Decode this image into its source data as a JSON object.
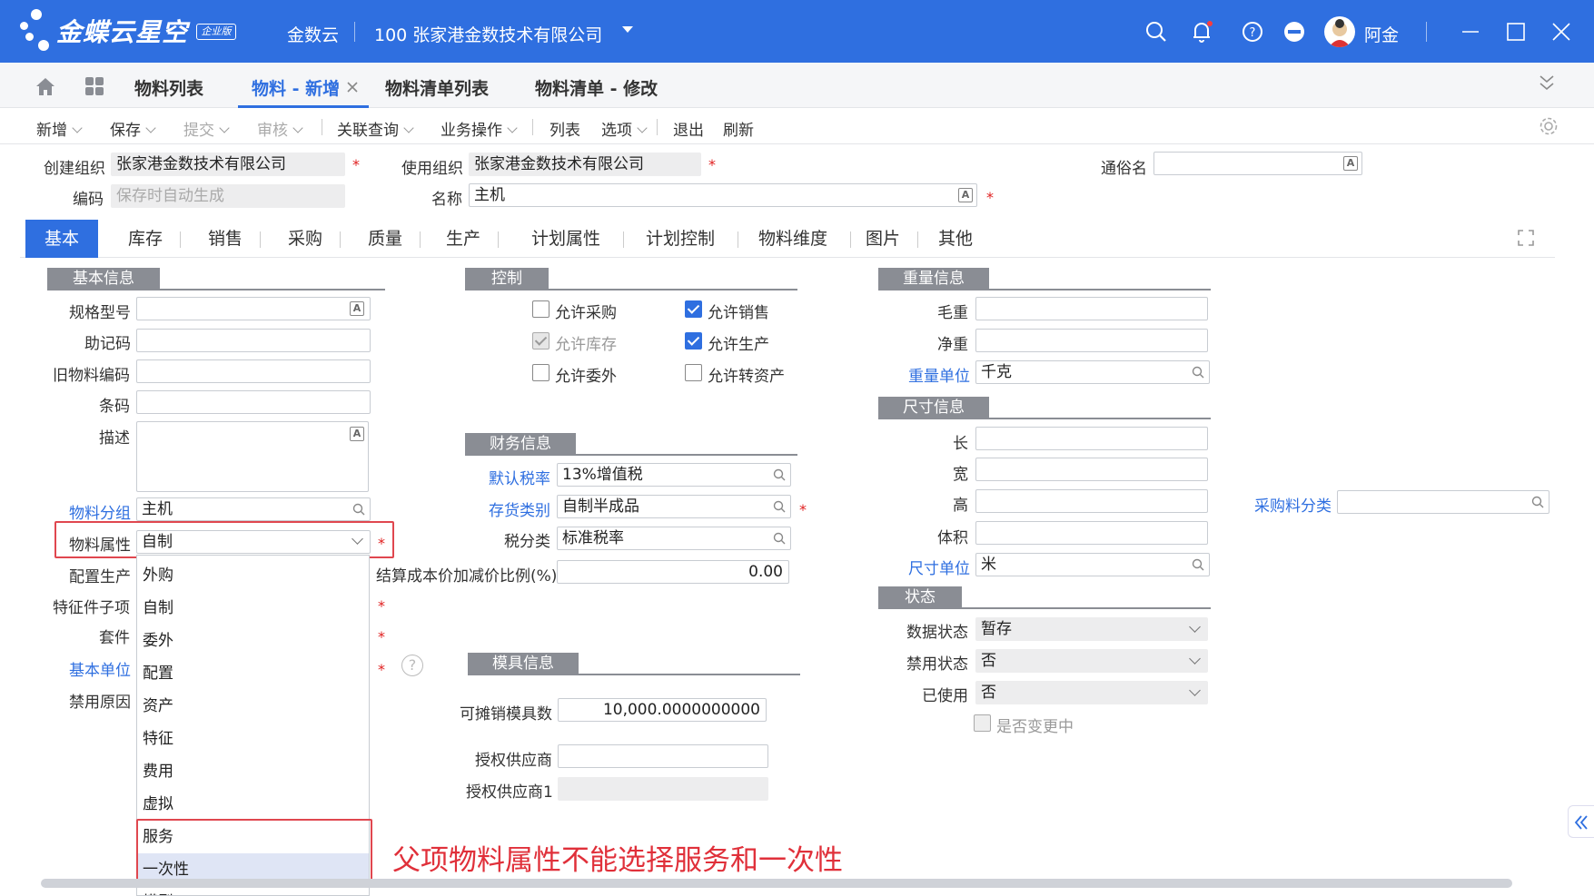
{
  "header": {
    "logo_text": "金蝶云星空",
    "logo_badge": "企业版",
    "product": "金数云",
    "org": "100 张家港金数技术有限公司",
    "username": "阿金",
    "brand_color": "#2f6fe0"
  },
  "tabs": [
    "物料列表",
    "物料 - 新增",
    "物料清单列表",
    "物料清单 - 修改"
  ],
  "toolbar": {
    "new": "新增",
    "save": "保存",
    "submit": "提交",
    "audit": "审核",
    "related": "关联查询",
    "business": "业务操作",
    "list": "列表",
    "options": "选项",
    "exit": "退出",
    "refresh": "刷新"
  },
  "top_form": {
    "create_org_label": "创建组织",
    "create_org_value": "张家港金数技术有限公司",
    "use_org_label": "使用组织",
    "use_org_value": "张家港金数技术有限公司",
    "alias_label": "通俗名",
    "code_label": "编码",
    "code_placeholder": "保存时自动生成",
    "name_label": "名称",
    "name_value": "主机"
  },
  "subtabs": [
    "基本",
    "库存",
    "销售",
    "采购",
    "质量",
    "生产",
    "计划属性",
    "计划控制",
    "物料维度",
    "图片",
    "其他"
  ],
  "basic": {
    "section": "基本信息",
    "spec": "规格型号",
    "mnemonic": "助记码",
    "old_code": "旧物料编码",
    "barcode": "条码",
    "desc": "描述",
    "group_label": "物料分组",
    "group_value": "主机",
    "attr_label": "物料属性",
    "attr_value": "自制",
    "config_prod": "配置生产",
    "feature_sub": "特征件子项",
    "kit": "套件",
    "base_unit": "基本单位",
    "disable_reason": "禁用原因"
  },
  "dropdown": {
    "options": [
      "外购",
      "自制",
      "委外",
      "配置",
      "资产",
      "特征",
      "费用",
      "虚拟",
      "服务",
      "一次性",
      "模型"
    ]
  },
  "annotation": "父项物料属性不能选择服务和一次性",
  "control": {
    "section": "控制",
    "allow_purchase": "允许采购",
    "allow_sales": "允许销售",
    "allow_stock": "允许库存",
    "allow_produce": "允许生产",
    "allow_outsource": "允许委外",
    "allow_asset": "允许转资产"
  },
  "finance": {
    "section": "财务信息",
    "tax_label": "默认税率",
    "tax_value": "13%增值税",
    "stock_cat_label": "存货类别",
    "stock_cat_value": "自制半成品",
    "tax_cat_label": "税分类",
    "tax_cat_value": "标准税率",
    "ratio_label": "结算成本价加减价比例(%)",
    "ratio_value": "0.00"
  },
  "mold": {
    "section": "模具信息",
    "count_label": "可摊销模具数",
    "count_value": "10,000.0000000000",
    "supplier_label": "授权供应商",
    "supplier1_label": "授权供应商1"
  },
  "weight": {
    "section": "重量信息",
    "gross": "毛重",
    "net": "净重",
    "unit_label": "重量单位",
    "unit_value": "千克"
  },
  "size": {
    "section": "尺寸信息",
    "length": "长",
    "width": "宽",
    "height": "高",
    "volume": "体积",
    "unit_label": "尺寸单位",
    "unit_value": "米",
    "purchase_cat": "采购料分类"
  },
  "status": {
    "section": "状态",
    "data_label": "数据状态",
    "data_value": "暂存",
    "disable_label": "禁用状态",
    "disable_value": "否",
    "used_label": "已使用",
    "used_value": "否",
    "changing": "是否变更中"
  }
}
